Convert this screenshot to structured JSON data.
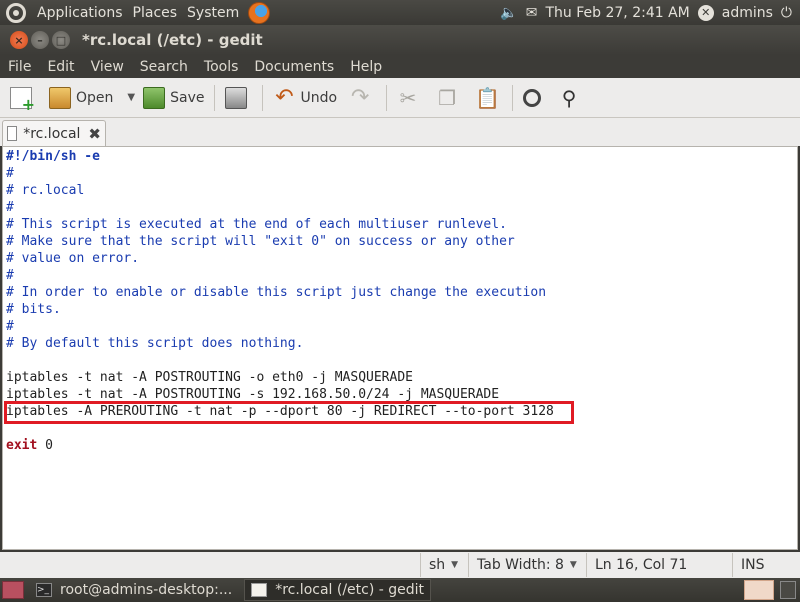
{
  "top_panel": {
    "menus": [
      "Applications",
      "Places",
      "System"
    ],
    "datetime": "Thu Feb 27,  2:41 AM",
    "user": "admins"
  },
  "window": {
    "title": "*rc.local (/etc) - gedit"
  },
  "menubar": [
    "File",
    "Edit",
    "View",
    "Search",
    "Tools",
    "Documents",
    "Help"
  ],
  "toolbar": {
    "open_label": "Open",
    "save_label": "Save",
    "undo_label": "Undo"
  },
  "tab": {
    "label": "*rc.local"
  },
  "editor": {
    "lines": [
      "#!/bin/sh -e",
      "#",
      "# rc.local",
      "#",
      "# This script is executed at the end of each multiuser runlevel.",
      "# Make sure that the script will \"exit 0\" on success or any other",
      "# value on error.",
      "#",
      "# In order to enable or disable this script just change the execution",
      "# bits.",
      "#",
      "# By default this script does nothing.",
      "",
      "iptables -t nat -A POSTROUTING -o eth0 -j MASQUERADE",
      "iptables -t nat -A POSTROUTING -s 192.168.50.0/24 -j MASQUERADE",
      "iptables -A PREROUTING -t nat -p --dport 80 -j REDIRECT --to-port 3128",
      "",
      "exit 0"
    ],
    "highlighted_line": 16
  },
  "statusbar": {
    "language": "sh",
    "tab_width": "Tab Width:  8",
    "position": "Ln 16, Col 71",
    "mode": "INS"
  },
  "bottom_panel": {
    "tasks": [
      "root@admins-desktop:...",
      "*rc.local (/etc) - gedit"
    ]
  }
}
